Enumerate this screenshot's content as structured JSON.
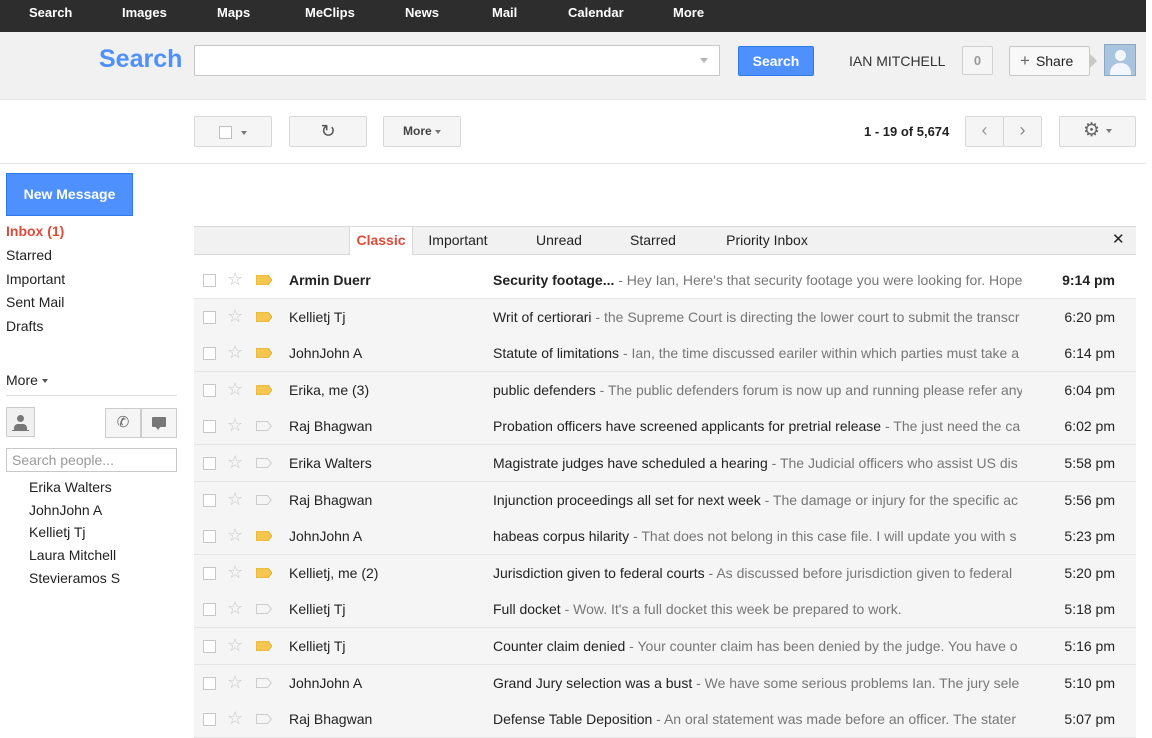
{
  "topnav": [
    "Search",
    "Images",
    "Maps",
    "MeClips",
    "News",
    "Mail",
    "Calendar",
    "More"
  ],
  "header": {
    "logo": "Search",
    "search_value": "",
    "search_button": "Search",
    "user_name": "IAN MITCHELL",
    "notifications": "0",
    "share_label": "Share"
  },
  "toolbar": {
    "more_label": "More",
    "pager": "1 - 19 of 5,674"
  },
  "sidebar": {
    "compose_label": "New Message",
    "folders": [
      "Inbox (1)",
      "Starred",
      "Important",
      "Sent Mail",
      "Drafts"
    ],
    "more_label": "More",
    "people_search_placeholder": "Search people...",
    "contacts": [
      "Erika Walters",
      "JohnJohn A",
      "Kellietj Tj",
      "Laura Mitchell",
      "Stevieramos S"
    ]
  },
  "tabs": {
    "items": [
      "Classic",
      "Important",
      "Unread",
      "Starred",
      "Priority Inbox"
    ],
    "active": "Classic",
    "close_glyph": "✕"
  },
  "colors": {
    "accent_blue": "#4d90fe",
    "active_red": "#dd4b39",
    "important_marker": "#f5c74e"
  },
  "messages": [
    {
      "sender": "Armin Duerr",
      "subject": "Security footage...",
      "snippet": " - Hey Ian, Here's that security footage you were looking for. Hope",
      "time": "9:14 pm",
      "unread": true,
      "important": true
    },
    {
      "sender": "Kellietj Tj",
      "subject": "Writ of certiorari",
      "snippet": " - the Supreme Court is directing the lower court to submit the transcr",
      "time": "6:20 pm",
      "unread": false,
      "important": true
    },
    {
      "sender": "JohnJohn A",
      "subject": "Statute of limitations",
      "snippet": " - Ian, the time discussed eariler within which parties must take a",
      "time": "6:14 pm",
      "unread": false,
      "important": true
    },
    {
      "sender": "Erika, me (3)",
      "subject": "public defenders",
      "snippet": " - The public defenders forum is now up and running please refer any",
      "time": "6:04 pm",
      "unread": false,
      "important": true
    },
    {
      "sender": "Raj Bhagwan",
      "subject": "Probation officers have screened applicants for pretrial release",
      "snippet": " - The just need the ca",
      "time": "6:02 pm",
      "unread": false,
      "important": false
    },
    {
      "sender": "Erika Walters",
      "subject": "Magistrate judges have scheduled a hearing",
      "snippet": " - The Judicial officers who assist US dis",
      "time": "5:58 pm",
      "unread": false,
      "important": false
    },
    {
      "sender": "Raj Bhagwan",
      "subject": "Injunction proceedings all set for next week",
      "snippet": " - The damage or injury for the specific ac",
      "time": "5:56 pm",
      "unread": false,
      "important": false
    },
    {
      "sender": "JohnJohn A",
      "subject": "habeas corpus hilarity",
      "snippet": " - That does not belong in this case file. I will update you with s",
      "time": "5:23 pm",
      "unread": false,
      "important": true
    },
    {
      "sender": "Kellietj, me (2)",
      "subject": "Jurisdiction given to federal courts",
      "snippet": " - As discussed before jurisdiction given to federal",
      "time": "5:20 pm",
      "unread": false,
      "important": true
    },
    {
      "sender": "Kellietj Tj",
      "subject": "Full docket",
      "snippet": " - Wow. It's a full docket this week be prepared to work.",
      "time": "5:18 pm",
      "unread": false,
      "important": false
    },
    {
      "sender": "Kellietj Tj",
      "subject": "Counter claim denied",
      "snippet": " - Your counter claim has been denied by the judge. You have o",
      "time": "5:16 pm",
      "unread": false,
      "important": true
    },
    {
      "sender": "JohnJohn A",
      "subject": "Grand Jury selection was a bust",
      "snippet": " - We have some serious problems Ian. The jury sele",
      "time": "5:10 pm",
      "unread": false,
      "important": false
    },
    {
      "sender": "Raj Bhagwan",
      "subject": "Defense Table Deposition",
      "snippet": " - An oral statement was made before an officer. The stater",
      "time": "5:07 pm",
      "unread": false,
      "important": false
    }
  ]
}
